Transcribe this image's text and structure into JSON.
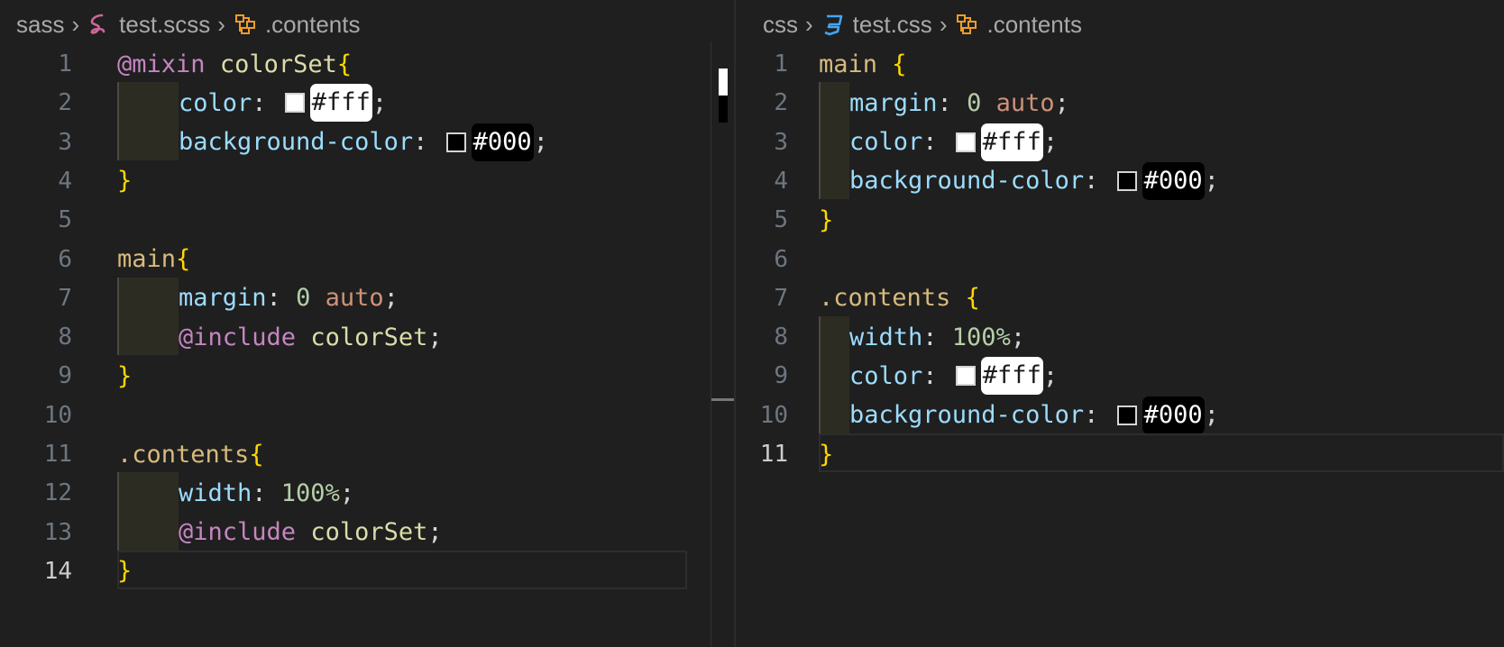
{
  "left_pane": {
    "breadcrumb": [
      {
        "label": "sass",
        "icon": "folder"
      },
      {
        "label": "test.scss",
        "icon": "sass-icon"
      },
      {
        "label": ".contents",
        "icon": "symbol-class-icon"
      }
    ],
    "lines": [
      {
        "n": "1",
        "tokens": [
          {
            "t": "@mixin",
            "c": "k-at"
          },
          {
            "t": " "
          },
          {
            "t": "colorSet",
            "c": "k-fn"
          },
          {
            "t": "{",
            "c": "k-brace"
          }
        ]
      },
      {
        "n": "2",
        "indent": true,
        "tokens": [
          {
            "t": "color",
            "c": "k-prop"
          },
          {
            "t": ": ",
            "c": "k-punc"
          },
          {
            "swatch": "#ffffff"
          },
          {
            "chip": "#fff",
            "theme": "white"
          },
          {
            "t": ";",
            "c": "k-punc"
          }
        ]
      },
      {
        "n": "3",
        "indent": true,
        "tokens": [
          {
            "t": "background-color",
            "c": "k-prop"
          },
          {
            "t": ": ",
            "c": "k-punc"
          },
          {
            "swatch": "#000000"
          },
          {
            "chip": "#000",
            "theme": "black"
          },
          {
            "t": ";",
            "c": "k-punc"
          }
        ]
      },
      {
        "n": "4",
        "tokens": [
          {
            "t": "}",
            "c": "k-brace"
          }
        ]
      },
      {
        "n": "5",
        "tokens": []
      },
      {
        "n": "6",
        "tokens": [
          {
            "t": "main",
            "c": "k-sel"
          },
          {
            "t": "{",
            "c": "k-brace"
          }
        ]
      },
      {
        "n": "7",
        "indent": true,
        "tokens": [
          {
            "t": "margin",
            "c": "k-prop"
          },
          {
            "t": ": ",
            "c": "k-punc"
          },
          {
            "t": "0",
            "c": "k-num"
          },
          {
            "t": " "
          },
          {
            "t": "auto",
            "c": "k-val"
          },
          {
            "t": ";",
            "c": "k-punc"
          }
        ]
      },
      {
        "n": "8",
        "indent": true,
        "tokens": [
          {
            "t": "@include",
            "c": "k-at"
          },
          {
            "t": " "
          },
          {
            "t": "colorSet",
            "c": "k-fn"
          },
          {
            "t": ";",
            "c": "k-punc"
          }
        ]
      },
      {
        "n": "9",
        "tokens": [
          {
            "t": "}",
            "c": "k-brace"
          }
        ]
      },
      {
        "n": "10",
        "tokens": []
      },
      {
        "n": "11",
        "tokens": [
          {
            "t": ".contents",
            "c": "k-sel"
          },
          {
            "t": "{",
            "c": "k-brace"
          }
        ]
      },
      {
        "n": "12",
        "indent": true,
        "tokens": [
          {
            "t": "width",
            "c": "k-prop"
          },
          {
            "t": ": ",
            "c": "k-punc"
          },
          {
            "t": "100%",
            "c": "k-num"
          },
          {
            "t": ";",
            "c": "k-punc"
          }
        ]
      },
      {
        "n": "13",
        "indent": true,
        "tokens": [
          {
            "t": "@include",
            "c": "k-at"
          },
          {
            "t": " "
          },
          {
            "t": "colorSet",
            "c": "k-fn"
          },
          {
            "t": ";",
            "c": "k-punc"
          }
        ]
      },
      {
        "n": "14",
        "active": true,
        "tokens": [
          {
            "t": "}",
            "c": "k-brace"
          }
        ]
      }
    ]
  },
  "right_pane": {
    "breadcrumb": [
      {
        "label": "css",
        "icon": "folder"
      },
      {
        "label": "test.css",
        "icon": "css-icon"
      },
      {
        "label": ".contents",
        "icon": "symbol-class-icon"
      }
    ],
    "lines": [
      {
        "n": "1",
        "tokens": [
          {
            "t": "main",
            "c": "k-sel"
          },
          {
            "t": " "
          },
          {
            "t": "{",
            "c": "k-brace"
          }
        ]
      },
      {
        "n": "2",
        "indent": true,
        "tokens": [
          {
            "t": "margin",
            "c": "k-prop"
          },
          {
            "t": ": ",
            "c": "k-punc"
          },
          {
            "t": "0",
            "c": "k-num"
          },
          {
            "t": " "
          },
          {
            "t": "auto",
            "c": "k-val"
          },
          {
            "t": ";",
            "c": "k-punc"
          }
        ]
      },
      {
        "n": "3",
        "indent": true,
        "tokens": [
          {
            "t": "color",
            "c": "k-prop"
          },
          {
            "t": ": ",
            "c": "k-punc"
          },
          {
            "swatch": "#ffffff"
          },
          {
            "chip": "#fff",
            "theme": "white"
          },
          {
            "t": ";",
            "c": "k-punc"
          }
        ]
      },
      {
        "n": "4",
        "indent": true,
        "tokens": [
          {
            "t": "background-color",
            "c": "k-prop"
          },
          {
            "t": ": ",
            "c": "k-punc"
          },
          {
            "swatch": "#000000"
          },
          {
            "chip": "#000",
            "theme": "black"
          },
          {
            "t": ";",
            "c": "k-punc"
          }
        ]
      },
      {
        "n": "5",
        "tokens": [
          {
            "t": "}",
            "c": "k-brace"
          }
        ]
      },
      {
        "n": "6",
        "tokens": []
      },
      {
        "n": "7",
        "tokens": [
          {
            "t": ".contents",
            "c": "k-sel"
          },
          {
            "t": " "
          },
          {
            "t": "{",
            "c": "k-brace"
          }
        ]
      },
      {
        "n": "8",
        "indent": true,
        "tokens": [
          {
            "t": "width",
            "c": "k-prop"
          },
          {
            "t": ": ",
            "c": "k-punc"
          },
          {
            "t": "100%",
            "c": "k-num"
          },
          {
            "t": ";",
            "c": "k-punc"
          }
        ]
      },
      {
        "n": "9",
        "indent": true,
        "tokens": [
          {
            "t": "color",
            "c": "k-prop"
          },
          {
            "t": ": ",
            "c": "k-punc"
          },
          {
            "swatch": "#ffffff"
          },
          {
            "chip": "#fff",
            "theme": "white"
          },
          {
            "t": ";",
            "c": "k-punc"
          }
        ]
      },
      {
        "n": "10",
        "indent": true,
        "tokens": [
          {
            "t": "background-color",
            "c": "k-prop"
          },
          {
            "t": ": ",
            "c": "k-punc"
          },
          {
            "swatch": "#000000"
          },
          {
            "chip": "#000",
            "theme": "black"
          },
          {
            "t": ";",
            "c": "k-punc"
          }
        ]
      },
      {
        "n": "11",
        "active": true,
        "tokens": [
          {
            "t": "}",
            "c": "k-brace"
          }
        ]
      }
    ]
  },
  "colors": {
    "sass_icon": "#cd6799",
    "css_icon": "#42a5f5",
    "class_icon": "#ee9d28"
  }
}
